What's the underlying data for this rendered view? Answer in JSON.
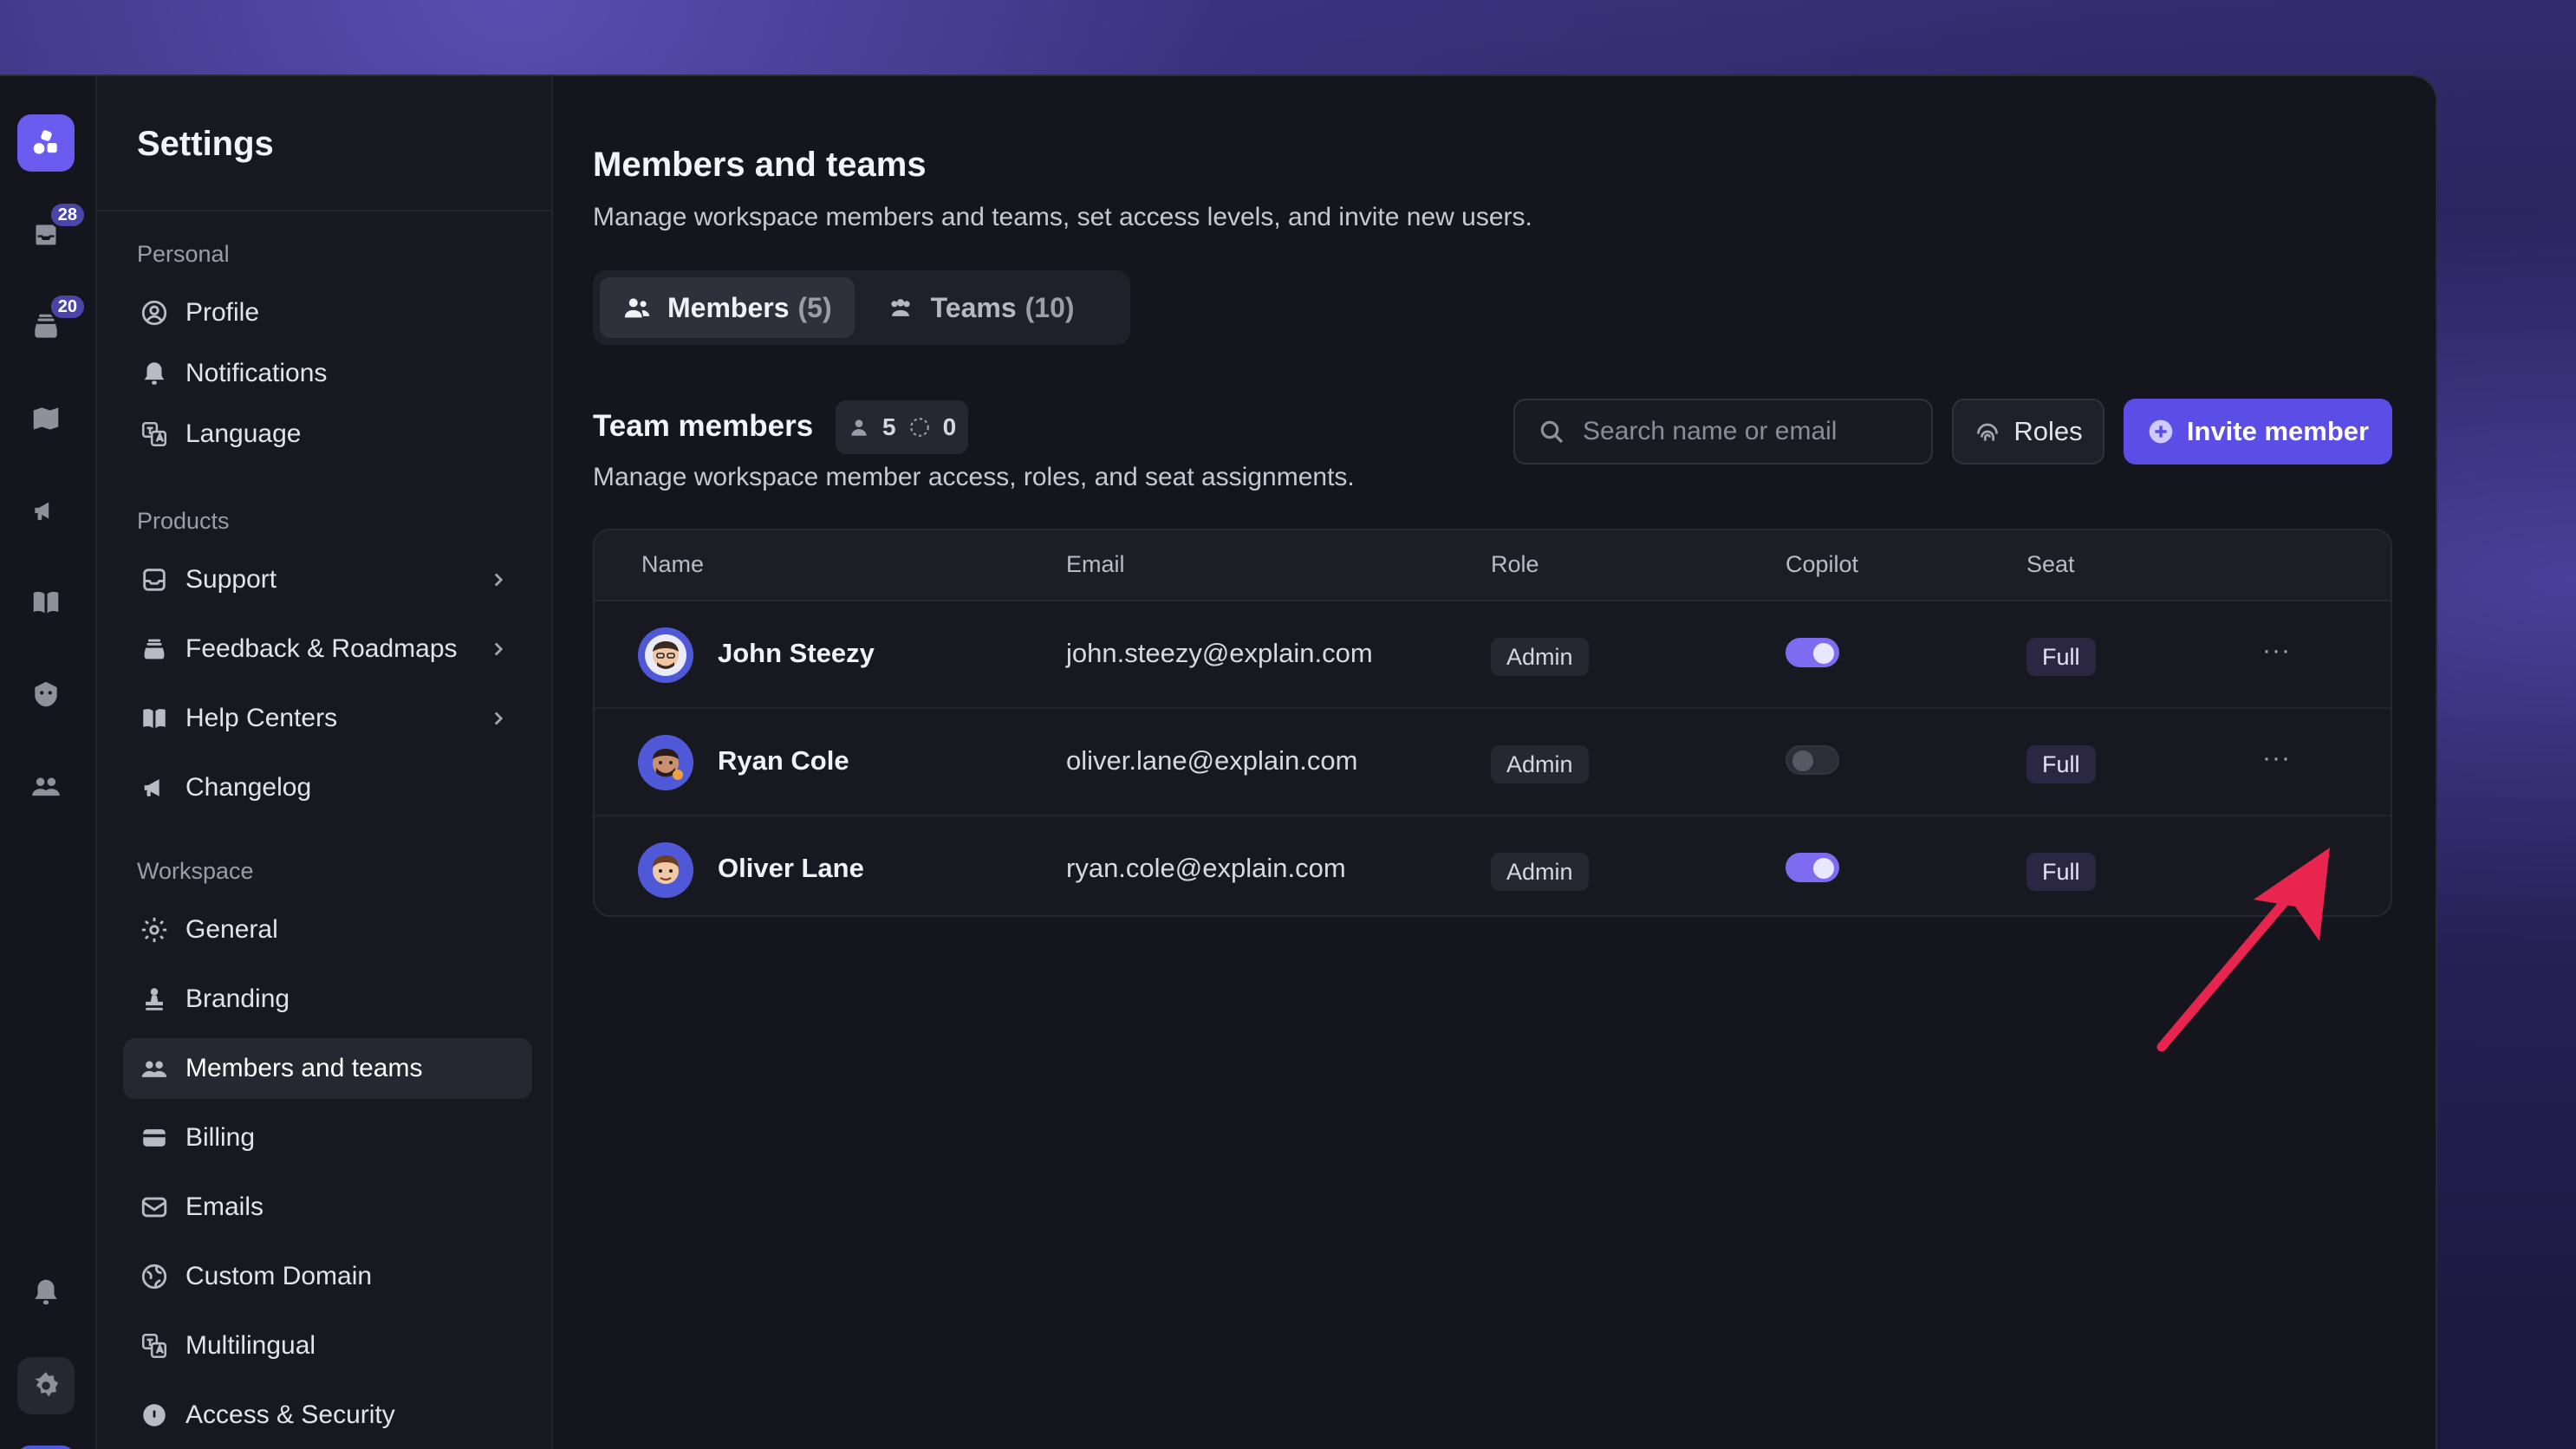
{
  "rail": {
    "inbox_badge": "28",
    "tickets_badge": "20"
  },
  "sidebar": {
    "title": "Settings",
    "sections": {
      "personal": "Personal",
      "products": "Products",
      "workspace": "Workspace"
    },
    "items": {
      "profile": "Profile",
      "notifications": "Notifications",
      "language": "Language",
      "support": "Support",
      "feedback": "Feedback & Roadmaps",
      "help_centers": "Help Centers",
      "changelog": "Changelog",
      "general": "General",
      "branding": "Branding",
      "members_teams": "Members and teams",
      "billing": "Billing",
      "emails": "Emails",
      "custom_domain": "Custom Domain",
      "multilingual": "Multilingual",
      "access_security": "Access & Security"
    }
  },
  "main": {
    "title": "Members and teams",
    "subtitle": "Manage workspace members and teams, set access levels, and invite new users.",
    "tabs": {
      "members_label": "Members",
      "members_count": "(5)",
      "teams_label": "Teams",
      "teams_count": "(10)"
    },
    "team_members": {
      "title": "Team members",
      "active_count": "5",
      "pending_count": "0",
      "subtitle": "Manage workspace member access, roles, and seat assignments."
    },
    "search": {
      "placeholder": "Search name or email"
    },
    "roles_label": "Roles",
    "invite_label": "Invite member",
    "table": {
      "headers": {
        "name": "Name",
        "email": "Email",
        "role": "Role",
        "copilot": "Copilot",
        "seat": "Seat"
      },
      "rows": [
        {
          "name": "John Steezy",
          "email": "john.steezy@explain.com",
          "role": "Admin",
          "copilot": true,
          "seat": "Full"
        },
        {
          "name": "Ryan Cole",
          "email": "oliver.lane@explain.com",
          "role": "Admin",
          "copilot": false,
          "seat": "Full"
        },
        {
          "name": "Oliver Lane",
          "email": "ryan.cole@explain.com",
          "role": "Admin",
          "copilot": true,
          "seat": "Full"
        }
      ],
      "more_glyph": "···"
    },
    "colors": {
      "accent": "#5a4ee6",
      "toggle_on": "#7d6cf0",
      "annotation_arrow": "#e8254f"
    }
  }
}
